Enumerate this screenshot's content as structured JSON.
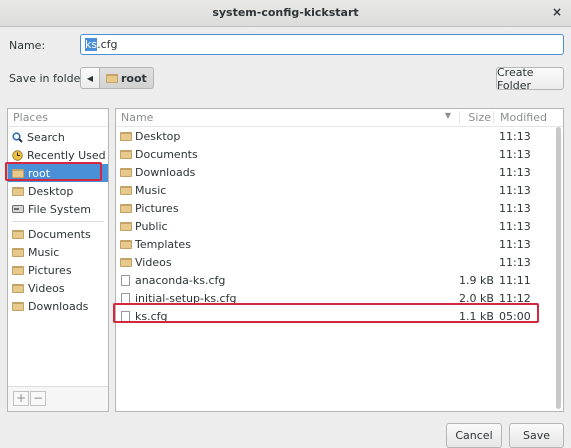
{
  "window": {
    "title": "system-config-kickstart",
    "close_glyph": "×"
  },
  "name_row": {
    "label": "Name:",
    "value_selected": "ks",
    "value_rest": ".cfg"
  },
  "folder_row": {
    "label": "Save in folder:",
    "back_glyph": "◀",
    "current": "root"
  },
  "create_folder_label": "Create Folder",
  "places": {
    "header": "Places",
    "items": [
      {
        "label": "Search",
        "icon": "search-icon"
      },
      {
        "label": "Recently Used",
        "icon": "clock-icon"
      },
      {
        "label": "root",
        "icon": "folder-icon",
        "selected": true
      },
      {
        "label": "Desktop",
        "icon": "folder-icon"
      },
      {
        "label": "File System",
        "icon": "drive-icon"
      },
      {
        "label": "Documents",
        "icon": "folder-icon"
      },
      {
        "label": "Music",
        "icon": "folder-icon"
      },
      {
        "label": "Pictures",
        "icon": "folder-icon"
      },
      {
        "label": "Videos",
        "icon": "folder-icon"
      },
      {
        "label": "Downloads",
        "icon": "folder-icon"
      }
    ],
    "add_glyph": "+",
    "remove_glyph": "−"
  },
  "files": {
    "columns": {
      "name": "Name",
      "size": "Size",
      "modified": "Modified"
    },
    "rows": [
      {
        "name": "Desktop",
        "size": "",
        "modified": "11:13",
        "type": "folder"
      },
      {
        "name": "Documents",
        "size": "",
        "modified": "11:13",
        "type": "folder"
      },
      {
        "name": "Downloads",
        "size": "",
        "modified": "11:13",
        "type": "folder"
      },
      {
        "name": "Music",
        "size": "",
        "modified": "11:13",
        "type": "folder"
      },
      {
        "name": "Pictures",
        "size": "",
        "modified": "11:13",
        "type": "folder"
      },
      {
        "name": "Public",
        "size": "",
        "modified": "11:13",
        "type": "folder"
      },
      {
        "name": "Templates",
        "size": "",
        "modified": "11:13",
        "type": "folder"
      },
      {
        "name": "Videos",
        "size": "",
        "modified": "11:13",
        "type": "folder"
      },
      {
        "name": "anaconda-ks.cfg",
        "size": "1.9 kB",
        "modified": "11:11",
        "type": "file"
      },
      {
        "name": "initial-setup-ks.cfg",
        "size": "2.0 kB",
        "modified": "11:12",
        "type": "file"
      },
      {
        "name": "ks.cfg",
        "size": "1.1 kB",
        "modified": "05:00",
        "type": "file"
      }
    ]
  },
  "buttons": {
    "cancel": "Cancel",
    "save": "Save"
  },
  "colors": {
    "selection": "#4a90d9",
    "highlight_box": "#d6283d",
    "folder": "#c4a165"
  }
}
